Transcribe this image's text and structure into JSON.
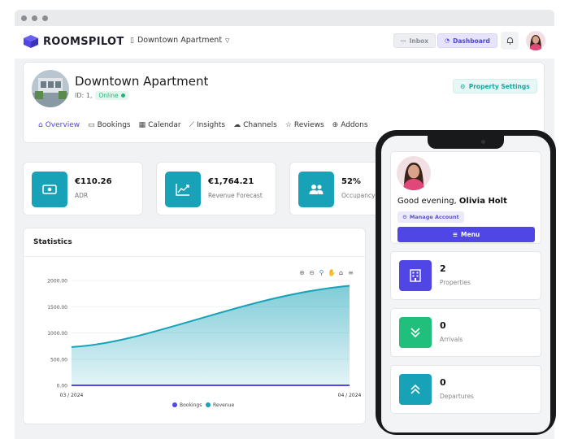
{
  "header": {
    "brand": "ROOMSPILOT",
    "property_select": "Downtown Apartment",
    "inbox_label": "Inbox",
    "dashboard_label": "Dashboard"
  },
  "property": {
    "title": "Downtown Apartment",
    "id_text": "ID: 1,",
    "status": "Online",
    "settings_label": "Property Settings"
  },
  "tabs": [
    {
      "label": "Overview",
      "icon": "home-icon"
    },
    {
      "label": "Bookings",
      "icon": "suitcase-icon"
    },
    {
      "label": "Calendar",
      "icon": "calendar-icon"
    },
    {
      "label": "Insights",
      "icon": "chart-line-icon"
    },
    {
      "label": "Channels",
      "icon": "cloud-icon"
    },
    {
      "label": "Reviews",
      "icon": "star-icon"
    },
    {
      "label": "Addons",
      "icon": "plus-circle-icon"
    }
  ],
  "stats": [
    {
      "value": "€110.26",
      "label": "ADR",
      "icon": "money-icon"
    },
    {
      "value": "€1,764.21",
      "label": "Revenue Forecast",
      "icon": "trend-icon"
    },
    {
      "value": "52%",
      "label": "Occupancy",
      "icon": "users-icon"
    }
  ],
  "statistics": {
    "title": "Statistics"
  },
  "chart_data": {
    "type": "area",
    "x": [
      "03 / 2024",
      "04 / 2024"
    ],
    "series": [
      {
        "name": "Bookings",
        "values": [
          0,
          0
        ],
        "color": "#4f46e5"
      },
      {
        "name": "Revenue",
        "values": [
          730,
          1900
        ],
        "color": "#17a2b8"
      }
    ],
    "yticks": [
      "0.00",
      "500.00",
      "1000.00",
      "1500.00",
      "2000.00"
    ],
    "ylim": [
      0,
      2000
    ],
    "legend": "bottom"
  },
  "mobile": {
    "greeting_prefix": "Good evening, ",
    "greeting_name": "Olivia Holt",
    "manage_label": "Manage Account",
    "menu_label": "Menu",
    "cards": [
      {
        "value": "2",
        "label": "Properties",
        "color": "#4f46e5",
        "icon": "building-icon"
      },
      {
        "value": "0",
        "label": "Arrivals",
        "color": "#20c07c",
        "icon": "chevron-down-icon"
      },
      {
        "value": "0",
        "label": "Departures",
        "color": "#17a2b8",
        "icon": "chevron-up-icon"
      }
    ]
  },
  "colors": {
    "primary": "#4f46e5",
    "teal": "#17a2b8",
    "online": "#1fb57a"
  }
}
